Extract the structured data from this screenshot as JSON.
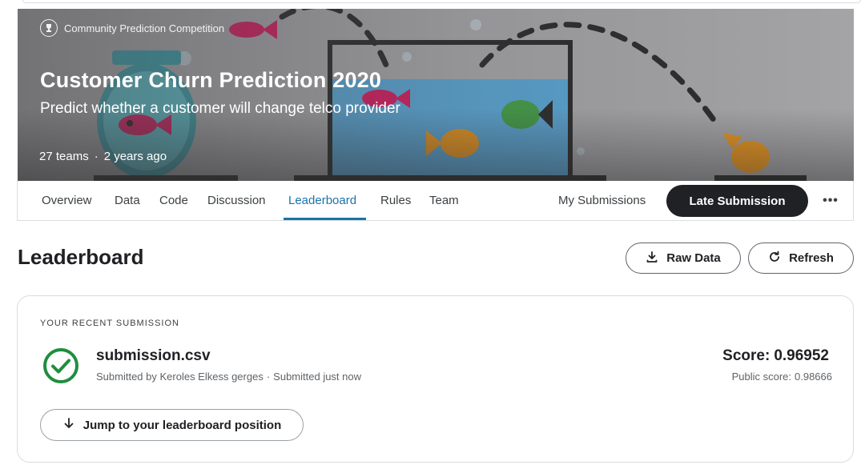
{
  "competition": {
    "badge": "Community Prediction Competition",
    "title": "Customer Churn Prediction 2020",
    "subtitle": "Predict whether a customer will change telco provider",
    "teams": "27 teams",
    "separator": "·",
    "age": "2 years ago"
  },
  "tabs": [
    {
      "label": "Overview",
      "active": false
    },
    {
      "label": "Data",
      "active": false
    },
    {
      "label": "Code",
      "active": false
    },
    {
      "label": "Discussion",
      "active": false
    },
    {
      "label": "Leaderboard",
      "active": true
    },
    {
      "label": "Rules",
      "active": false
    },
    {
      "label": "Team",
      "active": false
    }
  ],
  "header_actions": {
    "my_submissions": "My Submissions",
    "late_submission": "Late Submission",
    "more": "•••"
  },
  "leaderboard": {
    "title": "Leaderboard",
    "raw_data_label": "Raw Data",
    "refresh_label": "Refresh"
  },
  "recent_submission": {
    "section_label": "YOUR RECENT SUBMISSION",
    "file_name": "submission.csv",
    "submitted_by": "Submitted by Keroles Elkess gerges",
    "separator": "·",
    "submitted_when": "Submitted just now",
    "score_label": "Score:",
    "score_value": "0.96952",
    "public_score_label": "Public score:",
    "public_score_value": "0.98666",
    "jump_label": "Jump to your leaderboard position"
  },
  "colors": {
    "accent": "#1a73a8",
    "dark_button": "#202124",
    "success": "#1e8e3e"
  },
  "icons": [
    "trophy-icon",
    "download-icon",
    "refresh-icon",
    "check-circle-icon",
    "arrow-down-icon",
    "more-icon"
  ]
}
